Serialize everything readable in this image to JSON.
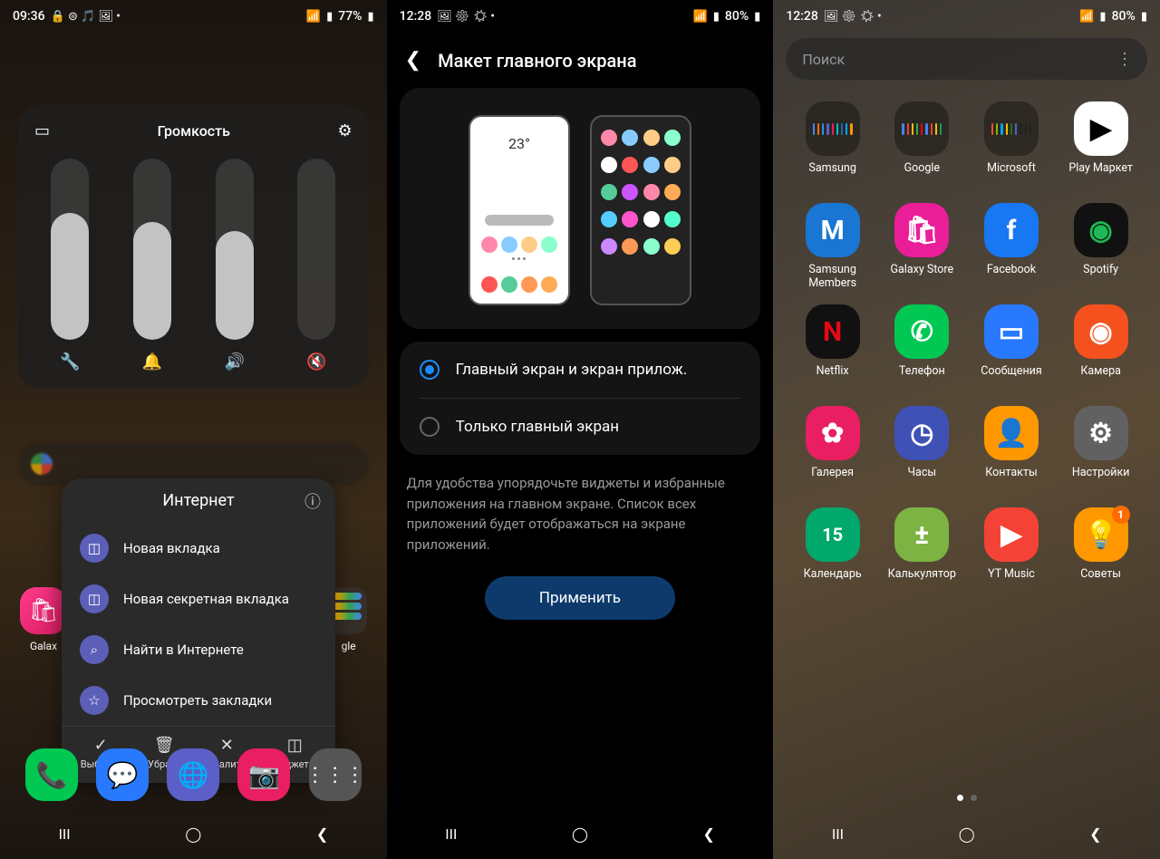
{
  "phone1": {
    "status": {
      "time": "09:36",
      "icons": "🔒 ⊜ 🎵 🖼 •",
      "wifi": "📶",
      "signal": "▮▯",
      "battery": "77%"
    },
    "volume": {
      "title": "Громкость",
      "sliders": [
        {
          "icon": "wrench",
          "level": 70
        },
        {
          "icon": "bell",
          "level": 65
        },
        {
          "icon": "speaker",
          "level": 60
        },
        {
          "icon": "mute",
          "level": 0
        }
      ]
    },
    "context": {
      "title": "Интернет",
      "items": [
        {
          "icon": "tab",
          "label": "Новая вкладка"
        },
        {
          "icon": "tab",
          "label": "Новая секретная вкладка"
        },
        {
          "icon": "search",
          "label": "Найти в Интернете"
        },
        {
          "icon": "star",
          "label": "Просмотреть закладки"
        }
      ],
      "actions": [
        {
          "icon": "✓",
          "label": "Выбрать"
        },
        {
          "icon": "🗑",
          "label": "Убрать"
        },
        {
          "icon": "✕",
          "label": "Удалить"
        },
        {
          "icon": "◫",
          "label": "Виджеты"
        }
      ]
    },
    "left_app": "Galax",
    "right_app": "gle",
    "dock_colors": [
      "#0bb04b",
      "#2196f3",
      "#5b5fc7",
      "#e91e63",
      "#555"
    ]
  },
  "phone2": {
    "status": {
      "time": "12:28",
      "icons": "🖼 ⚙ ☀ •",
      "battery": "80%"
    },
    "title": "Макет главного экрана",
    "mock_temp": "23°",
    "opt1": "Главный экран и экран прилож.",
    "opt2": "Только главный экран",
    "desc": "Для удобства упорядочьте виджеты и избранные приложения на главном экране. Список всех приложений будет отображаться на экране приложений.",
    "apply": "Применить"
  },
  "phone3": {
    "status": {
      "time": "12:28",
      "icons": "🖼 ⚙ ☀ •",
      "battery": "80%"
    },
    "search_placeholder": "Поиск",
    "apps": [
      {
        "name": "Samsung",
        "type": "folder",
        "colors": [
          "#4285f4",
          "#ff6b00",
          "#2196f3",
          "#5b5fc7",
          "#e91e63",
          "#0bb",
          "#1565c0",
          "#03a9f4",
          "#ff9800"
        ]
      },
      {
        "name": "Google",
        "type": "folder",
        "colors": [
          "#4285f4",
          "#ea4335",
          "#fbbc05",
          "#34a853",
          "#ff0000",
          "#4285f4",
          "#ea4335",
          "#fbbc05",
          "#0f9d58"
        ]
      },
      {
        "name": "Microsoft",
        "type": "folder",
        "colors": [
          "#f25022",
          "#7fba00",
          "#00a4ef",
          "#ffb900",
          "#107c10",
          "#5b5fc7",
          "#222",
          "#222",
          "#222"
        ]
      },
      {
        "name": "Play Маркет",
        "type": "icon",
        "bg": "#fff",
        "glyph": "▶",
        "fg": "linear-gradient(135deg,#00c853,#2196f3,#ffea00,#f44336)"
      },
      {
        "name": "Samsung Members",
        "type": "icon",
        "bg": "#1976d2",
        "glyph": "M",
        "txt": "#fff"
      },
      {
        "name": "Galaxy Store",
        "type": "icon",
        "bg": "#e91e98",
        "glyph": "🛍",
        "txt": "#fff"
      },
      {
        "name": "Facebook",
        "type": "icon",
        "bg": "#1877f2",
        "glyph": "f",
        "txt": "#fff"
      },
      {
        "name": "Spotify",
        "type": "icon",
        "bg": "#111",
        "glyph": "◉",
        "txt": "#1db954"
      },
      {
        "name": "Netflix",
        "type": "icon",
        "bg": "#111",
        "glyph": "N",
        "txt": "#e50914"
      },
      {
        "name": "Телефон",
        "type": "icon",
        "bg": "#00c853",
        "glyph": "✆",
        "txt": "#fff"
      },
      {
        "name": "Сообщения",
        "type": "icon",
        "bg": "#2979ff",
        "glyph": "▭",
        "txt": "#fff"
      },
      {
        "name": "Камера",
        "type": "icon",
        "bg": "#f4511e",
        "glyph": "◉",
        "txt": "#fff"
      },
      {
        "name": "Галерея",
        "type": "icon",
        "bg": "#e91e63",
        "glyph": "✿",
        "txt": "#fff"
      },
      {
        "name": "Часы",
        "type": "icon",
        "bg": "#3f51b5",
        "glyph": "◷",
        "txt": "#fff"
      },
      {
        "name": "Контакты",
        "type": "icon",
        "bg": "#ff9800",
        "glyph": "👤",
        "txt": "#fff"
      },
      {
        "name": "Настройки",
        "type": "icon",
        "bg": "#616161",
        "glyph": "⚙",
        "txt": "#fff"
      },
      {
        "name": "Календарь",
        "type": "icon",
        "bg": "#00a86b",
        "glyph": "15",
        "txt": "#fff",
        "sz": "20px"
      },
      {
        "name": "Калькулятор",
        "type": "icon",
        "bg": "#7cb342",
        "glyph": "±",
        "txt": "#fff"
      },
      {
        "name": "YT Music",
        "type": "icon",
        "bg": "#f44336",
        "glyph": "▶",
        "txt": "#fff"
      },
      {
        "name": "Советы",
        "type": "icon",
        "bg": "#ff9800",
        "glyph": "💡",
        "txt": "#fff",
        "badge": "1"
      }
    ]
  }
}
